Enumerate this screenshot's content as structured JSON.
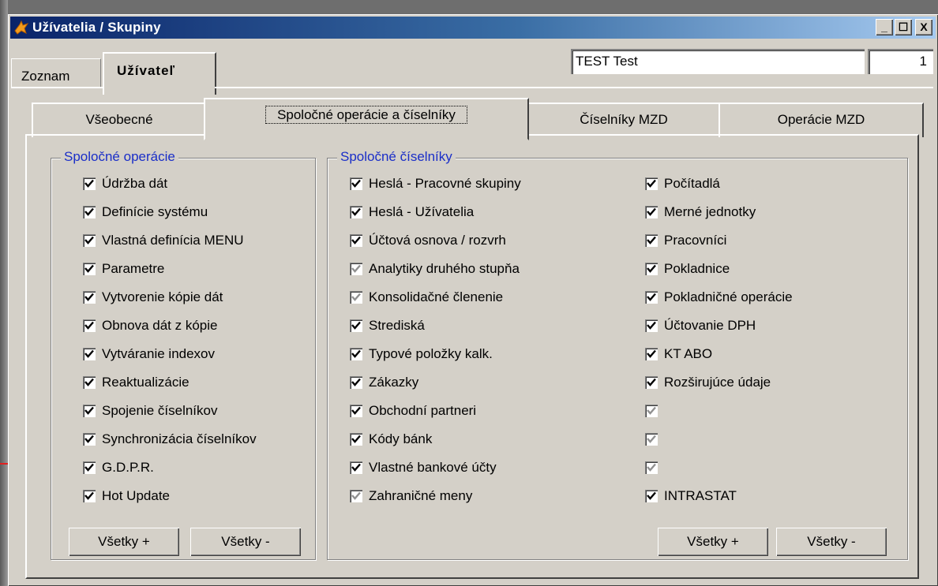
{
  "window": {
    "title": "Užívatelia / Skupiny",
    "min_glyph": "_",
    "max_glyph": "☐",
    "close_glyph": "X"
  },
  "top_tabs": [
    "Zoznam",
    "Užívateľ"
  ],
  "user_field": {
    "name": "TEST Test",
    "number": "1"
  },
  "inner_tabs": [
    "Všeobecné",
    "Spoločné operácie a číselníky",
    "Číselníky MZD",
    "Operácie MZD"
  ],
  "operacie": {
    "title": "Spoločné operácie",
    "items": [
      {
        "label": "Údržba dát",
        "checked": true,
        "disabled": false
      },
      {
        "label": "Definície systému",
        "checked": true,
        "disabled": false
      },
      {
        "label": "Vlastná definícia MENU",
        "checked": true,
        "disabled": false
      },
      {
        "label": "Parametre",
        "checked": true,
        "disabled": false
      },
      {
        "label": "Vytvorenie kópie dát",
        "checked": true,
        "disabled": false
      },
      {
        "label": "Obnova dát z kópie",
        "checked": true,
        "disabled": false
      },
      {
        "label": "Vytváranie indexov",
        "checked": true,
        "disabled": false
      },
      {
        "label": "Reaktualizácie",
        "checked": true,
        "disabled": false
      },
      {
        "label": "Spojenie číselníkov",
        "checked": true,
        "disabled": false
      },
      {
        "label": "Synchronizácia číselníkov",
        "checked": true,
        "disabled": false
      },
      {
        "label": "G.D.P.R.",
        "checked": true,
        "disabled": false
      },
      {
        "label": "Hot Update",
        "checked": true,
        "disabled": false
      }
    ],
    "btn_all_plus": "Všetky +",
    "btn_all_minus": "Všetky -"
  },
  "ciselniky": {
    "title": "Spoločné číselníky",
    "col1": [
      {
        "label": "Heslá - Pracovné skupiny",
        "checked": true,
        "disabled": false
      },
      {
        "label": "Heslá - Užívatelia",
        "checked": true,
        "disabled": false
      },
      {
        "label": "Účtová osnova / rozvrh",
        "checked": true,
        "disabled": false
      },
      {
        "label": "Analytiky druhého stupňa",
        "checked": true,
        "disabled": true
      },
      {
        "label": "Konsolidačné členenie",
        "checked": true,
        "disabled": true
      },
      {
        "label": "Strediská",
        "checked": true,
        "disabled": false
      },
      {
        "label": "Typové položky kalk.",
        "checked": true,
        "disabled": false
      },
      {
        "label": "Zákazky",
        "checked": true,
        "disabled": false
      },
      {
        "label": "Obchodní partneri",
        "checked": true,
        "disabled": false
      },
      {
        "label": "Kódy bánk",
        "checked": true,
        "disabled": false
      },
      {
        "label": "Vlastné bankové účty",
        "checked": true,
        "disabled": false
      },
      {
        "label": "Zahraničné meny",
        "checked": true,
        "disabled": true
      }
    ],
    "col2": [
      {
        "label": "Počítadlá",
        "checked": true,
        "disabled": false
      },
      {
        "label": "Merné jednotky",
        "checked": true,
        "disabled": false
      },
      {
        "label": "Pracovníci",
        "checked": true,
        "disabled": false
      },
      {
        "label": "Pokladnice",
        "checked": true,
        "disabled": false
      },
      {
        "label": "Pokladničné operácie",
        "checked": true,
        "disabled": false
      },
      {
        "label": "Účtovanie DPH",
        "checked": true,
        "disabled": false
      },
      {
        "label": "KT ABO",
        "checked": true,
        "disabled": false
      },
      {
        "label": "Rozširujúce údaje",
        "checked": true,
        "disabled": false
      },
      {
        "label": "",
        "checked": true,
        "disabled": true
      },
      {
        "label": "",
        "checked": true,
        "disabled": true
      },
      {
        "label": "",
        "checked": true,
        "disabled": true
      },
      {
        "label": "INTRASTAT",
        "checked": true,
        "disabled": false
      }
    ],
    "btn_all_plus": "Všetky +",
    "btn_all_minus": "Všetky -"
  }
}
